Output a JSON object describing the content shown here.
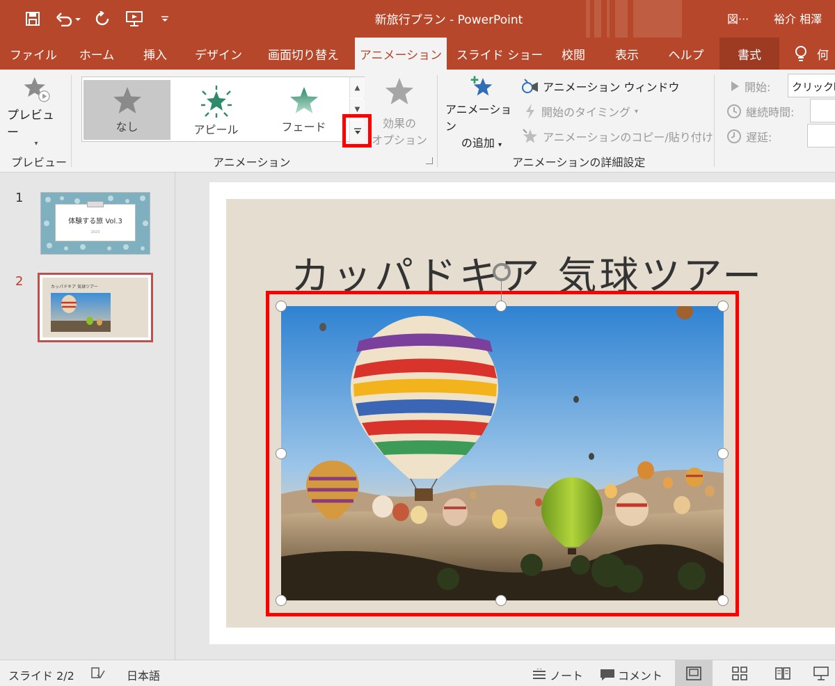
{
  "window": {
    "title": "新旅行プラン  -  PowerPoint",
    "right_icon_label": "図···",
    "user_name": "裕介 相澤"
  },
  "quick_access": {
    "icons": [
      "save-icon",
      "undo-icon",
      "redo-icon",
      "start-presentation-icon",
      "customize-icon"
    ]
  },
  "tabs": [
    {
      "label": "ファイル"
    },
    {
      "label": "ホーム"
    },
    {
      "label": "挿入"
    },
    {
      "label": "デザイン"
    },
    {
      "label": "画面切り替え"
    },
    {
      "label": "アニメーション",
      "active": true
    },
    {
      "label": "スライド ショー"
    },
    {
      "label": "校閲"
    },
    {
      "label": "表示"
    },
    {
      "label": "ヘルプ"
    },
    {
      "label": "書式"
    },
    {
      "label": "何"
    }
  ],
  "ribbon": {
    "preview_group": {
      "button_label": "プレビュー",
      "group_label": "プレビュー"
    },
    "animation_group": {
      "gallery": [
        {
          "label": "なし",
          "selected": true
        },
        {
          "label": "アピール"
        },
        {
          "label": "フェード"
        }
      ],
      "effect_options_line1": "効果の",
      "effect_options_line2": "オプション",
      "group_label": "アニメーション"
    },
    "advanced_group": {
      "add_animation_line1": "アニメーション",
      "add_animation_line2": "の追加",
      "animation_pane": "アニメーション ウィンドウ",
      "trigger": "開始のタイミング",
      "animation_painter": "アニメーションのコピー/貼り付け",
      "group_label": "アニメーションの詳細設定"
    },
    "timing_group": {
      "start_label": "開始:",
      "start_value": "クリック時",
      "duration_label": "継続時間:",
      "delay_label": "遅延:"
    }
  },
  "slides": [
    {
      "number": "1",
      "thumb_title": "体験する旅 Vol.3",
      "thumb_sub": "2023"
    },
    {
      "number": "2",
      "thumb_title": "カッパドキア 気球ツアー",
      "active": true
    }
  ],
  "current_slide": {
    "title": "カッパドキア 気球ツアー"
  },
  "status_bar": {
    "slide_info": "スライド 2/2",
    "language": "日本語",
    "notes": "ノート",
    "comments": "コメント"
  },
  "colors": {
    "accent": "#b7472a",
    "highlight": "#ff0000",
    "slide_background": "#e4ddd0"
  }
}
